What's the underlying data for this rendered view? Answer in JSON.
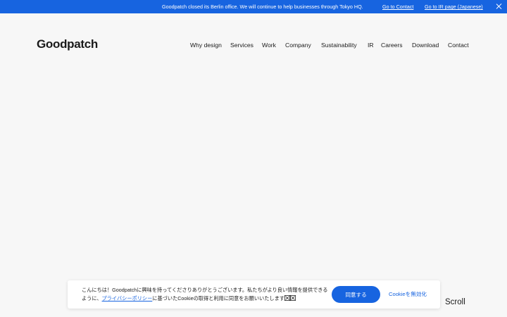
{
  "announcement": {
    "message": "Goodpatch closed its Berlin office. We will continue to help businesses through Tokyo HQ.",
    "contact_link": "Go to Contact",
    "ir_link": "Go to IR page (Japanese)"
  },
  "header": {
    "logo": "Goodpatch",
    "nav": [
      "Why design",
      "Services",
      "Work",
      "Company",
      "Sustainability",
      "IR",
      "Careers",
      "Download",
      "Contact"
    ]
  },
  "cookie_banner": {
    "text_before": "こんにちは！Goodpatchに興味を持ってくださりありがとうございます。私たちがより良い情報を提供できるように、",
    "policy_link": "プライバシーポリシー",
    "text_after": "に基づいたCookieの取得と利用に同意をお願いいたします",
    "agree_button": "同意する",
    "disable_button": "Cookieを無効化"
  },
  "scroll_label": "Scroll",
  "colors": {
    "accent": "#1764e0",
    "background": "#f7f7f7"
  }
}
